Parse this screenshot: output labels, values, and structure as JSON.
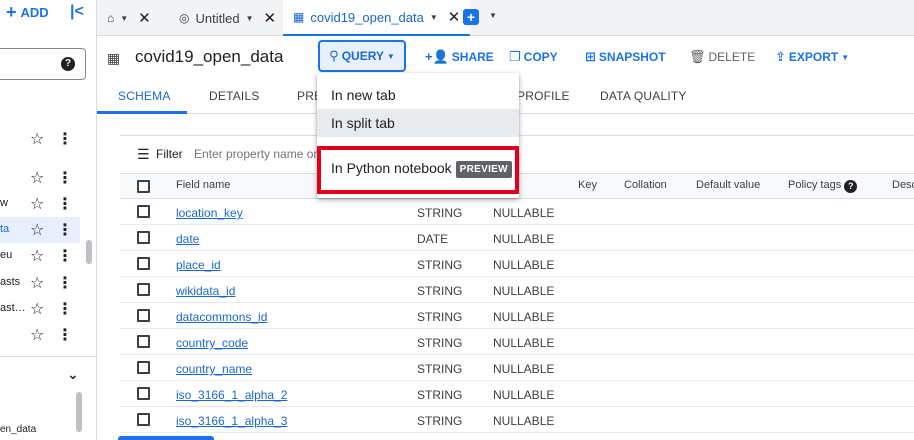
{
  "explorer": {
    "add_label": "ADD",
    "collapse_icon": "collapse-left-icon",
    "help_glyph": "?",
    "tree_items": [
      {
        "label": "",
        "selected": false
      },
      {
        "label": "",
        "selected": false
      },
      {
        "label": "w",
        "selected": false
      },
      {
        "label": "ta",
        "selected": true
      },
      {
        "label": "eu",
        "selected": false
      },
      {
        "label": "asts",
        "selected": false
      },
      {
        "label": "ast…",
        "selected": false
      },
      {
        "label": "",
        "selected": false
      }
    ],
    "bottom_label": "en_data"
  },
  "tabs": [
    {
      "label": "",
      "icon": "home-icon",
      "active": false
    },
    {
      "label": "Untitled",
      "icon": "query-icon",
      "active": false
    },
    {
      "label": "covid19_open_data",
      "icon": "table-icon",
      "active": true
    }
  ],
  "toolbar": {
    "title": "covid19_open_data",
    "query_label": "QUERY",
    "share_label": "SHARE",
    "copy_label": "COPY",
    "snapshot_label": "SNAPSHOT",
    "delete_label": "DELETE",
    "export_label": "EXPORT"
  },
  "subtabs": {
    "schema": "SCHEMA",
    "details": "DETAILS",
    "preview": "PRE",
    "profile": "PROFILE",
    "quality": "DATA QUALITY"
  },
  "filter": {
    "label": "Filter",
    "placeholder": "Enter property name or"
  },
  "schema_columns": {
    "field_name": "Field name",
    "key": "Key",
    "collation": "Collation",
    "default_value": "Default value",
    "policy_tags": "Policy tags",
    "description": "Desc"
  },
  "schema_rows": [
    {
      "name": "location_key",
      "type": "STRING",
      "mode": "NULLABLE"
    },
    {
      "name": "date",
      "type": "DATE",
      "mode": "NULLABLE"
    },
    {
      "name": "place_id",
      "type": "STRING",
      "mode": "NULLABLE"
    },
    {
      "name": "wikidata_id",
      "type": "STRING",
      "mode": "NULLABLE"
    },
    {
      "name": "datacommons_id",
      "type": "STRING",
      "mode": "NULLABLE"
    },
    {
      "name": "country_code",
      "type": "STRING",
      "mode": "NULLABLE"
    },
    {
      "name": "country_name",
      "type": "STRING",
      "mode": "NULLABLE"
    },
    {
      "name": "iso_3166_1_alpha_2",
      "type": "STRING",
      "mode": "NULLABLE"
    },
    {
      "name": "iso_3166_1_alpha_3",
      "type": "STRING",
      "mode": "NULLABLE"
    }
  ],
  "query_menu": {
    "new_tab": "In new tab",
    "split_tab": "In split tab",
    "python_notebook": "In Python notebook",
    "preview_badge": "PREVIEW"
  },
  "colors": {
    "accent": "#1a73e8",
    "highlight": "#e0001b"
  }
}
